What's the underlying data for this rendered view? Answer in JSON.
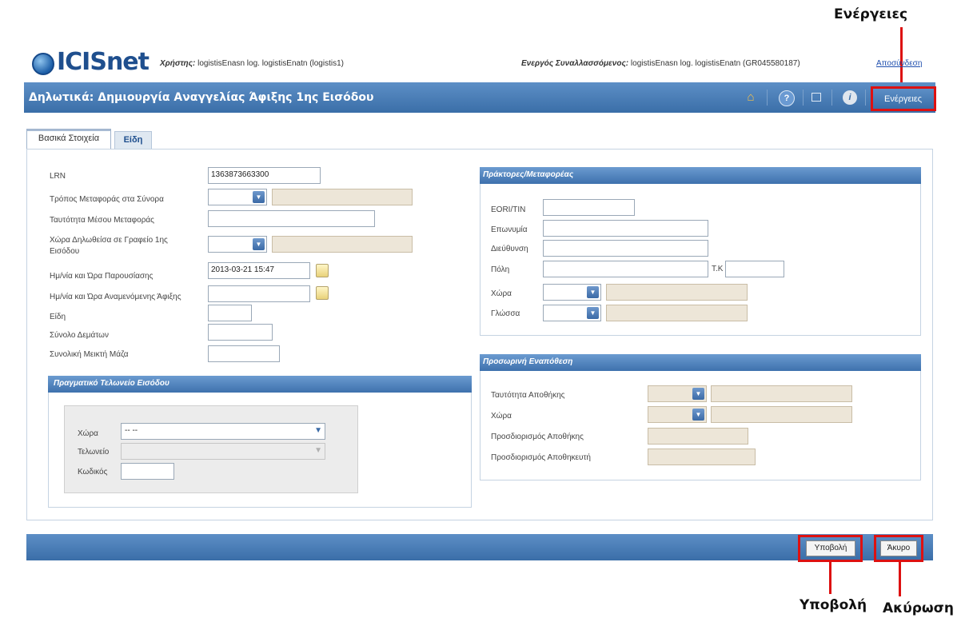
{
  "callouts": {
    "actions": "Ενέργειες",
    "submit": "Υποβολή",
    "cancel": "Ακύρωση"
  },
  "header": {
    "logo": "ICISnet",
    "user_label": "Χρήστης:",
    "user_value": "logistisEnasn log. logistisEnatn (logistis1)",
    "trader_label": "Ενεργός Συναλλασσόμενος:",
    "trader_value": "logistisEnasn log. logistisEnatn (GR045580187)",
    "logout": "Αποσύνδεση"
  },
  "titlebar": {
    "title": "Δηλωτικά: Δημιουργία Αναγγελίας Άφιξης 1ης Εισόδου",
    "icons": [
      "home-icon",
      "help-icon",
      "window-icon",
      "info-icon"
    ],
    "actions_button": "Ενέργειες"
  },
  "tabs": [
    {
      "label": "Βασικά Στοιχεία",
      "active": true
    },
    {
      "label": "Είδη",
      "active": false
    }
  ],
  "basic": {
    "lrn_label": "LRN",
    "lrn_value": "1363873663300",
    "transport_mode_label": "Τρόπος Μεταφοράς στα Σύνορα",
    "transport_id_label": "Ταυτότητα Μέσου Μεταφοράς",
    "country_office_label": "Χώρα Δηλωθείσα σε Γραφείο 1ης Εισόδου",
    "presentation_label": "Ημ/νία και Ώρα Παρουσίασης",
    "presentation_value": "2013-03-21 15:47",
    "expected_arrival_label": "Ημ/νία και Ώρα Αναμενόμενης Άφιξης",
    "items_label": "Είδη",
    "packages_label": "Σύνολο Δεμάτων",
    "gross_mass_label": "Συνολική Μεικτή Μάζα"
  },
  "actual_office": {
    "header": "Πραγματικό Τελωνείο Εισόδου",
    "country_label": "Χώρα",
    "country_value": "-- --",
    "office_label": "Τελωνείο",
    "code_label": "Κωδικός"
  },
  "agents": {
    "header": "Πράκτορες/Μεταφορέας",
    "eori_label": "EORI/TIN",
    "name_label": "Επωνυμία",
    "address_label": "Διεύθυνση",
    "city_label": "Πόλη",
    "postcode_label": "Τ.Κ",
    "country_label": "Χώρα",
    "language_label": "Γλώσσα"
  },
  "temp_storage": {
    "header": "Προσωρινή Εναπόθεση",
    "warehouse_id_label": "Ταυτότητα Αποθήκης",
    "country_label": "Χώρα",
    "warehouse_spec_label": "Προσδιορισμός Αποθήκης",
    "keeper_spec_label": "Προσδιορισμός Αποθηκευτή"
  },
  "footer": {
    "submit_button": "Υποβολή",
    "cancel_button": "Άκυρο"
  },
  "colors": {
    "brand_blue": "#3a6ea8",
    "highlight_red": "#d11111",
    "readonly_fill": "#ede6d8"
  }
}
